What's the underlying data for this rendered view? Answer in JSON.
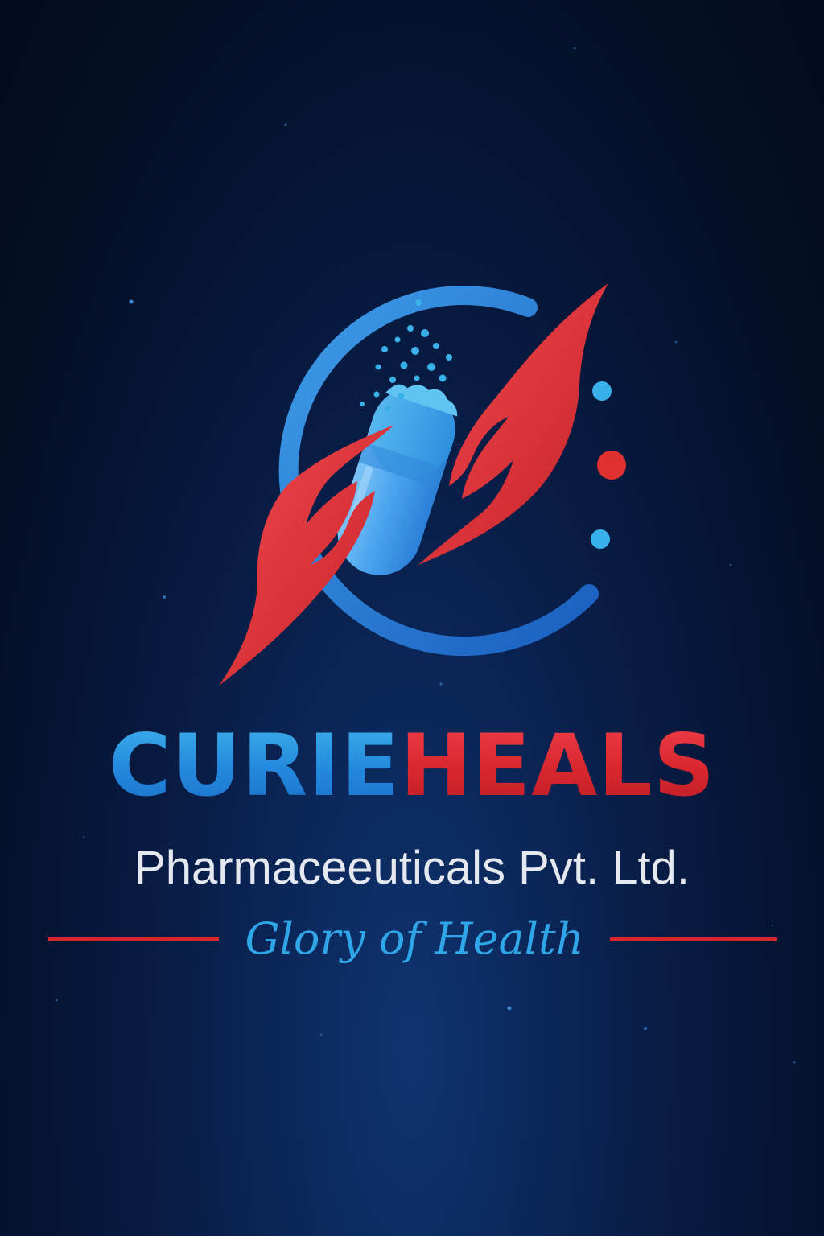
{
  "brand": {
    "name_part_1": "CURIE",
    "name_part_2": "HEALS"
  },
  "company": {
    "name": "Pharmaceeuticals Pvt. Ltd."
  },
  "tagline": "Glory of Health",
  "emblem": {
    "icon": "hands-holding-capsule-icon"
  },
  "colors": {
    "background": "#06173a",
    "brand_blue": "#2388dd",
    "brand_red": "#d8262e",
    "text_light": "#e6e8ef",
    "tagline_blue": "#2ea6e8"
  }
}
